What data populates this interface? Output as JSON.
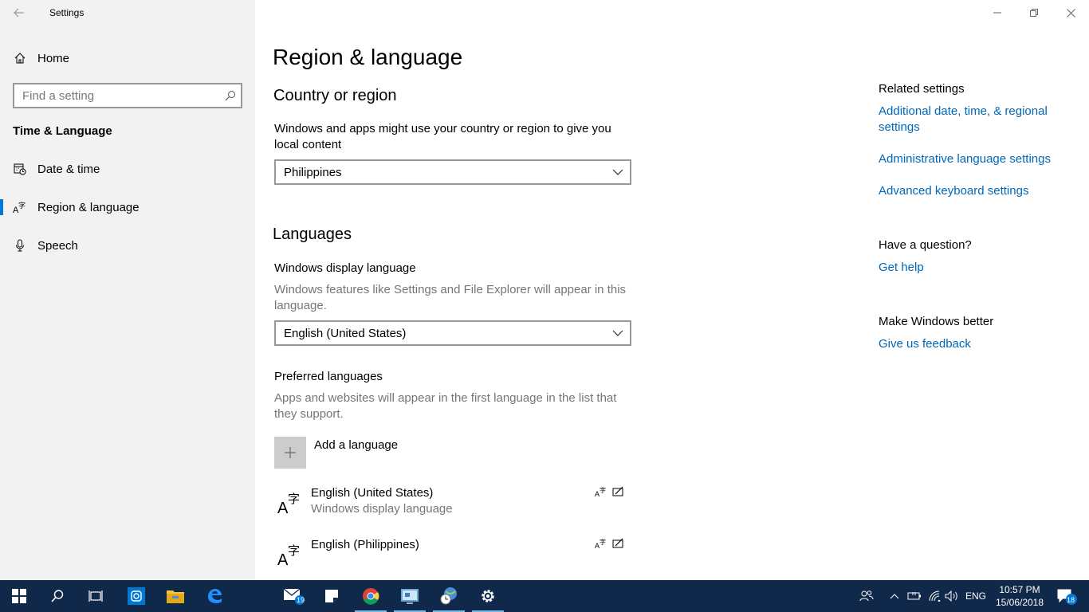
{
  "window": {
    "title": "Settings",
    "back_icon": "back-arrow-icon",
    "controls": [
      "minimize",
      "restore",
      "close"
    ]
  },
  "sidebar": {
    "home_label": "Home",
    "search_placeholder": "Find a setting",
    "section_title": "Time & Language",
    "items": [
      {
        "label": "Date & time",
        "icon": "calendar-clock-icon",
        "active": false
      },
      {
        "label": "Region & language",
        "icon": "language-icon",
        "active": true
      },
      {
        "label": "Speech",
        "icon": "microphone-icon",
        "active": false
      }
    ]
  },
  "main": {
    "page_title": "Region & language",
    "country": {
      "heading": "Country or region",
      "description": "Windows and apps might use your country or region to give you local content",
      "selected": "Philippines"
    },
    "languages": {
      "heading": "Languages",
      "display_label": "Windows display language",
      "display_desc": "Windows features like Settings and File Explorer will appear in this language.",
      "display_selected": "English (United States)",
      "preferred_label": "Preferred languages",
      "preferred_desc": "Apps and websites will appear in the first language in the list that they support.",
      "add_label": "Add a language",
      "list": [
        {
          "name": "English (United States)",
          "sub": "Windows display language"
        },
        {
          "name": "English (Philippines)",
          "sub": ""
        }
      ]
    }
  },
  "related": {
    "heading": "Related settings",
    "links": [
      "Additional date, time, & regional settings",
      "Administrative language settings",
      "Advanced keyboard settings"
    ],
    "question_heading": "Have a question?",
    "help_link": "Get help",
    "better_heading": "Make Windows better",
    "feedback_link": "Give us feedback"
  },
  "taskbar": {
    "mail_badge": "19",
    "lang": "ENG",
    "time": "10:57 PM",
    "date": "15/06/2018",
    "notif_badge": "18",
    "accent": "#0078d7",
    "link_color": "#0067b8"
  }
}
